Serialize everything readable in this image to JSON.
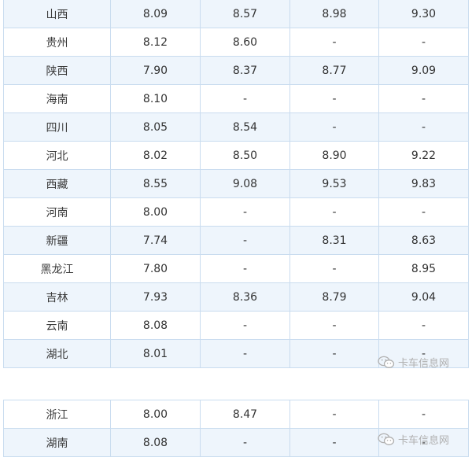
{
  "table_top": {
    "rows": [
      {
        "province": "山西",
        "c1": "8.09",
        "c2": "8.57",
        "c3": "8.98",
        "c4": "9.30",
        "shaded": true
      },
      {
        "province": "贵州",
        "c1": "8.12",
        "c2": "8.60",
        "c3": "-",
        "c4": "-",
        "shaded": false
      },
      {
        "province": "陕西",
        "c1": "7.90",
        "c2": "8.37",
        "c3": "8.77",
        "c4": "9.09",
        "shaded": true
      },
      {
        "province": "海南",
        "c1": "8.10",
        "c2": "-",
        "c3": "-",
        "c4": "-",
        "shaded": false
      },
      {
        "province": "四川",
        "c1": "8.05",
        "c2": "8.54",
        "c3": "-",
        "c4": "-",
        "shaded": true
      },
      {
        "province": "河北",
        "c1": "8.02",
        "c2": "8.50",
        "c3": "8.90",
        "c4": "9.22",
        "shaded": false
      },
      {
        "province": "西藏",
        "c1": "8.55",
        "c2": "9.08",
        "c3": "9.53",
        "c4": "9.83",
        "shaded": true
      },
      {
        "province": "河南",
        "c1": "8.00",
        "c2": "-",
        "c3": "-",
        "c4": "-",
        "shaded": false
      },
      {
        "province": "新疆",
        "c1": "7.74",
        "c2": "-",
        "c3": "8.31",
        "c4": "8.63",
        "shaded": true
      },
      {
        "province": "黑龙江",
        "c1": "7.80",
        "c2": "-",
        "c3": "-",
        "c4": "8.95",
        "shaded": false
      },
      {
        "province": "吉林",
        "c1": "7.93",
        "c2": "8.36",
        "c3": "8.79",
        "c4": "9.04",
        "shaded": true
      },
      {
        "province": "云南",
        "c1": "8.08",
        "c2": "-",
        "c3": "-",
        "c4": "-",
        "shaded": false
      },
      {
        "province": "湖北",
        "c1": "8.01",
        "c2": "-",
        "c3": "-",
        "c4": "-",
        "shaded": true
      }
    ]
  },
  "table_bottom": {
    "rows": [
      {
        "province": "浙江",
        "c1": "8.00",
        "c2": "8.47",
        "c3": "-",
        "c4": "-",
        "shaded": false
      },
      {
        "province": "湖南",
        "c1": "8.08",
        "c2": "-",
        "c3": "-",
        "c4": "-",
        "shaded": true
      }
    ]
  },
  "watermark": {
    "text": "卡车信息网",
    "icon": "wechat-icon",
    "color": "#b0b0b0"
  },
  "colors": {
    "border": "#c9dcef",
    "shade": "#eef5fc",
    "text": "#333333"
  }
}
